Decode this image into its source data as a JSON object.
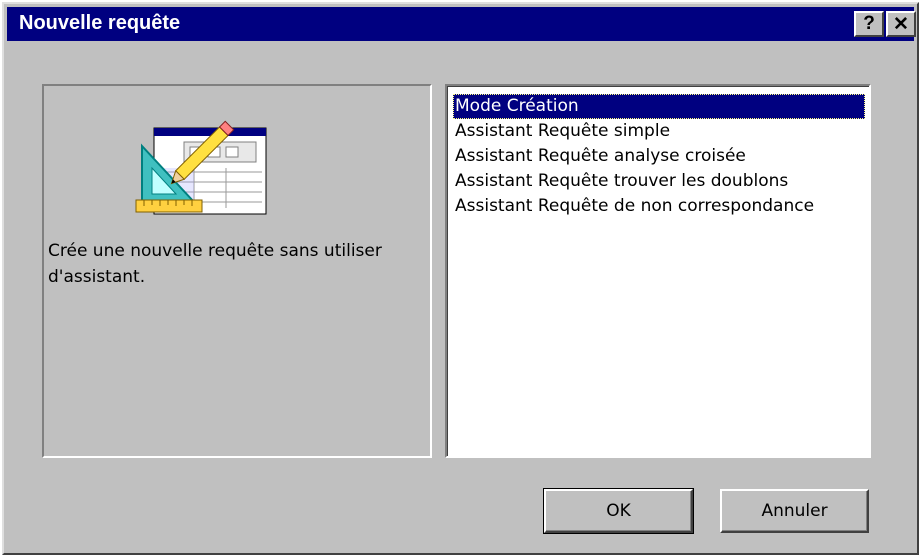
{
  "window": {
    "title": "Nouvelle requête",
    "help_glyph": "?",
    "close_glyph": "✕"
  },
  "preview": {
    "icon": "query-design-icon",
    "description": "Crée une nouvelle requête sans utiliser d'assistant."
  },
  "query_types": {
    "items": [
      {
        "label": "Mode Création",
        "selected": true
      },
      {
        "label": "Assistant Requête simple",
        "selected": false
      },
      {
        "label": "Assistant Requête analyse croisée",
        "selected": false
      },
      {
        "label": "Assistant Requête trouver les doublons",
        "selected": false
      },
      {
        "label": "Assistant Requête de non correspondance",
        "selected": false
      }
    ]
  },
  "buttons": {
    "ok_label": "OK",
    "cancel_label": "Annuler"
  },
  "colors": {
    "titlebar": "#000080",
    "face": "#c0c0c0",
    "selection": "#000080"
  }
}
